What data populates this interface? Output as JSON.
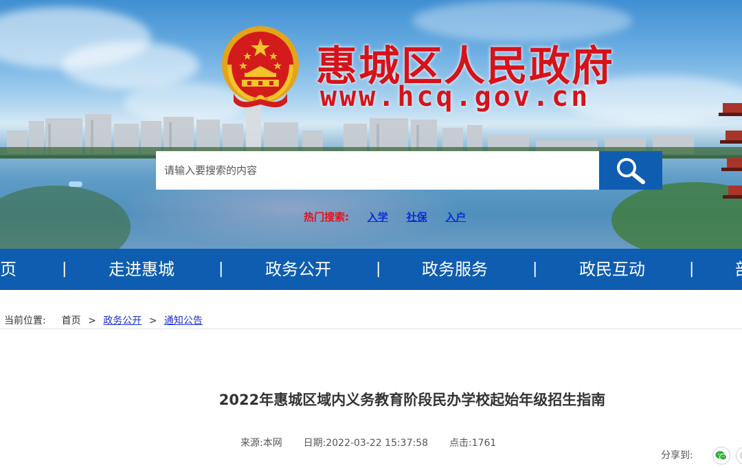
{
  "site": {
    "title": "惠城区人民政府",
    "url": "www.hcq.gov.cn"
  },
  "search": {
    "placeholder": "请输入要搜索的内容",
    "hot_label": "热门搜索:",
    "hot_links": [
      "入学",
      "社保",
      "入户"
    ]
  },
  "nav": {
    "items": [
      "首页",
      "走进惠城",
      "政务公开",
      "政务服务",
      "政民互动",
      "部门"
    ],
    "separator": "|"
  },
  "breadcrumb": {
    "label": "当前位置:",
    "items": [
      "首页",
      "政务公开",
      "通知公告"
    ],
    "separator": ">"
  },
  "article": {
    "title": "2022年惠城区域内义务教育阶段民办学校起始年级招生指南",
    "source_label": "来源:",
    "source": "本网",
    "date_label": "日期:",
    "date": "2022-03-22 15:37:58",
    "hits_label": "点击:",
    "hits": "1761"
  },
  "share": {
    "label": "分享到:",
    "icons": [
      "wechat-icon",
      "share-more-icon"
    ]
  },
  "colors": {
    "nav_bg": "#0e5db1",
    "title_red": "#d6121a",
    "hot_red": "#e3101b",
    "link_blue": "#0b2ad8"
  }
}
